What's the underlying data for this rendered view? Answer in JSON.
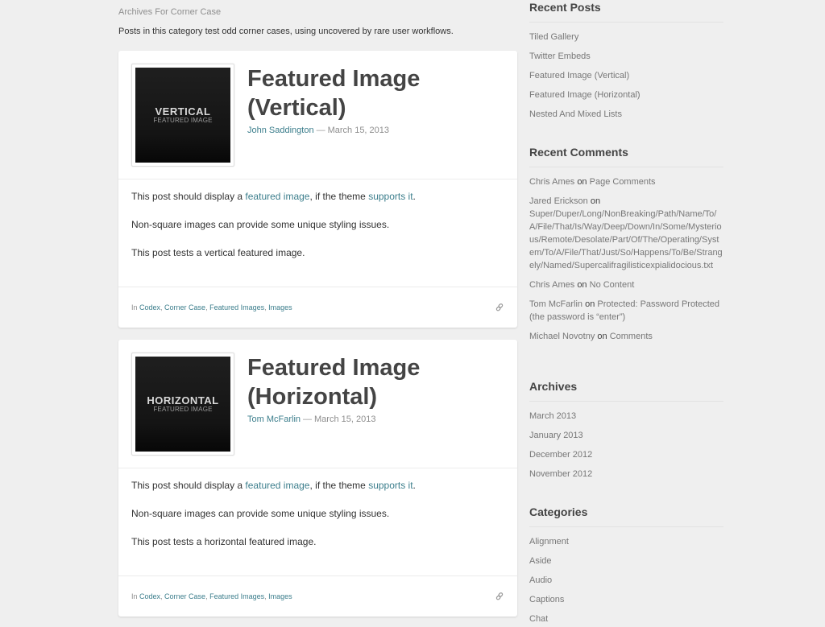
{
  "archive": {
    "title": "Archives For Corner Case",
    "description": "Posts in this category test odd corner cases, using uncovered by rare user workflows."
  },
  "posts": [
    {
      "thumb_big": "VERTICAL",
      "thumb_small": "FEATURED IMAGE",
      "title": "Featured Image (Vertical)",
      "author": "John Saddington",
      "separator": "—",
      "date": "March 15, 2013",
      "body": {
        "p1_before": "This post should display a ",
        "p1_link1": "featured image",
        "p1_mid": ", if the theme ",
        "p1_link2": "supports it",
        "p1_after": ".",
        "p2": "Non-square images can provide some unique styling issues.",
        "p3": "This post tests a vertical featured image."
      },
      "categories_prefix": "In ",
      "categories": [
        "Codex",
        "Corner Case",
        "Featured Images",
        "Images"
      ],
      "permalink_icon": "link-icon"
    },
    {
      "thumb_big": "HORIZONTAL",
      "thumb_small": "FEATURED IMAGE",
      "title": "Featured Image (Horizontal)",
      "author": "Tom McFarlin",
      "separator": "—",
      "date": "March 15, 2013",
      "body": {
        "p1_before": "This post should display a ",
        "p1_link1": "featured image",
        "p1_mid": ", if the theme ",
        "p1_link2": "supports it",
        "p1_after": ".",
        "p2": "Non-square images can provide some unique styling issues.",
        "p3": "This post tests a horizontal featured image."
      },
      "categories_prefix": "In ",
      "categories": [
        "Codex",
        "Corner Case",
        "Featured Images",
        "Images"
      ],
      "permalink_icon": "link-icon"
    }
  ],
  "sidebar": {
    "recent_posts": {
      "title": "Recent Posts",
      "items": [
        "Tiled Gallery",
        "Twitter Embeds",
        "Featured Image (Vertical)",
        "Featured Image (Horizontal)",
        "Nested And Mixed Lists"
      ]
    },
    "recent_comments": {
      "title": "Recent Comments",
      "on_word": "on",
      "items": [
        {
          "author": "Chris Ames",
          "post": "Page Comments"
        },
        {
          "author": "Jared Erickson",
          "post": "Super/Duper/Long/NonBreaking/Path/Name/To/A/File/That/Is/Way/Deep/Down/In/Some/Mysterious/Remote/Desolate/Part/Of/The/Operating/System/To/A/File/That/Just/So/Happens/To/Be/Strangely/Named/Supercalifragilisticexpialidocious.txt"
        },
        {
          "author": "Chris Ames",
          "post": "No Content"
        },
        {
          "author": "Tom McFarlin",
          "post": "Protected: Password Protected (the password is “enter”)"
        },
        {
          "author": "Michael Novotny",
          "post": "Comments"
        }
      ]
    },
    "archives": {
      "title": "Archives",
      "items": [
        "March 2013",
        "January 2013",
        "December 2012",
        "November 2012"
      ]
    },
    "categories": {
      "title": "Categories",
      "items": [
        "Alignment",
        "Aside",
        "Audio",
        "Captions",
        "Chat"
      ]
    }
  },
  "colors": {
    "link": "#3c7e8c",
    "background": "#efefef",
    "card": "#ffffff"
  }
}
